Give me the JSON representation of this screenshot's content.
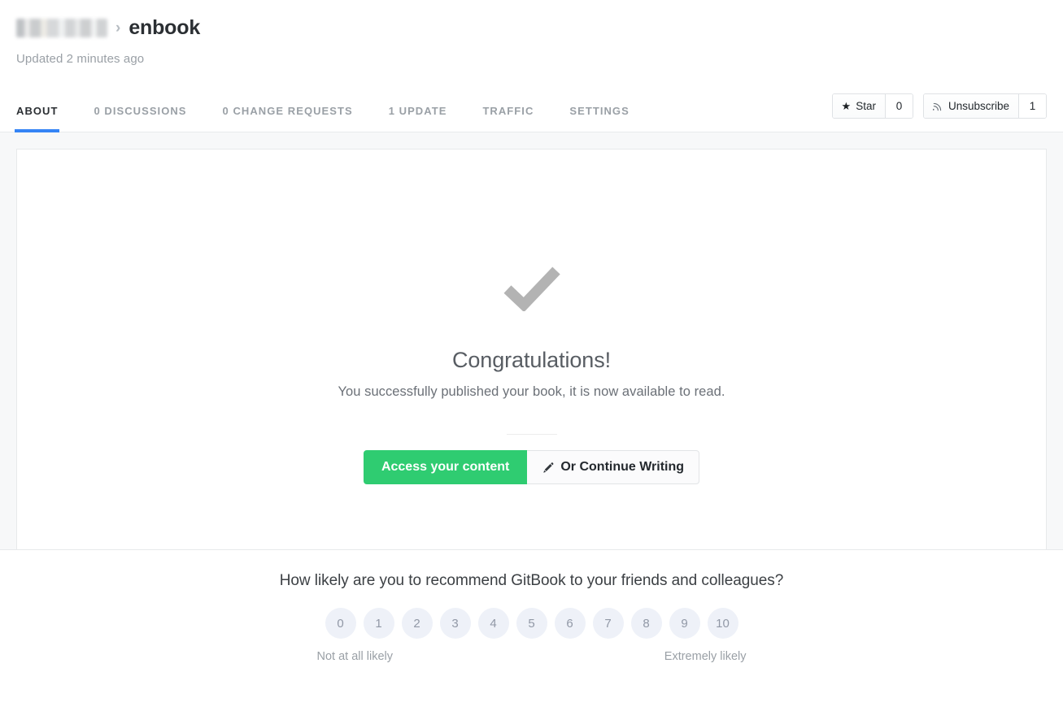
{
  "header": {
    "owner_redacted": true,
    "breadcrumb_separator": "›",
    "book_title": "enbook",
    "updated_text": "Updated 2 minutes ago"
  },
  "tabs": [
    {
      "label": "ABOUT",
      "active": true
    },
    {
      "label": "0 DISCUSSIONS",
      "active": false
    },
    {
      "label": "0 CHANGE REQUESTS",
      "active": false
    },
    {
      "label": "1 UPDATE",
      "active": false
    },
    {
      "label": "TRAFFIC",
      "active": false
    },
    {
      "label": "SETTINGS",
      "active": false
    }
  ],
  "header_actions": {
    "star": {
      "label": "Star",
      "icon": "star-icon",
      "count": "0"
    },
    "subscribe": {
      "label": "Unsubscribe",
      "icon": "rss-icon",
      "count": "1"
    }
  },
  "content": {
    "status_icon": "checkmark-icon",
    "title": "Congratulations!",
    "subtitle": "You successfully published your book, it is now available to read.",
    "primary_button": "Access your content",
    "secondary_button": "Or Continue Writing",
    "secondary_button_icon": "pencil-icon"
  },
  "survey": {
    "question": "How likely are you to recommend GitBook to your friends and colleagues?",
    "options": [
      "0",
      "1",
      "2",
      "3",
      "4",
      "5",
      "6",
      "7",
      "8",
      "9",
      "10"
    ],
    "low_label": "Not at all likely",
    "high_label": "Extremely likely"
  },
  "colors": {
    "accent_blue": "#3584f5",
    "primary_green": "#2fcc71",
    "page_background": "#f7f8f9",
    "nps_chip": "#eef1f8",
    "muted_text": "#9aa0a6"
  }
}
